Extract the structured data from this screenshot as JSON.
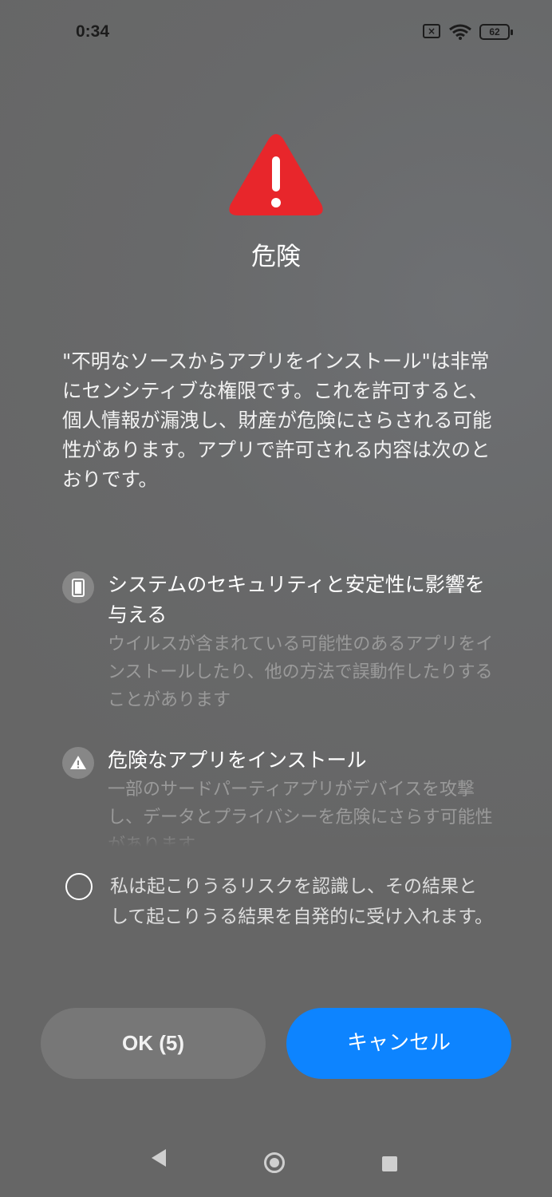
{
  "status_bar": {
    "time": "0:34",
    "battery": "62",
    "icons": [
      "sim-absent-icon",
      "wifi-icon",
      "battery-icon"
    ]
  },
  "dialog": {
    "warning_icon": "warning-triangle-icon",
    "title": "危険",
    "description": "\"不明なソースからアプリをインストール\"は非常にセンシティブな権限です。これを許可すると、個人情報が漏洩し、財産が危険にさらされる可能性があります。アプリで許可される内容は次のとおりです。",
    "items": [
      {
        "icon": "phone-icon",
        "title": "システムのセキュリティと安定性に影響を与える",
        "subtitle": "ウイルスが含まれている可能性のあるアプリをインストールしたり、他の方法で誤動作したりすることがあります"
      },
      {
        "icon": "warning-icon",
        "title": "危険なアプリをインストール",
        "subtitle": "一部のサードパーティアプリがデバイスを攻撃し、データとプライバシーを危険にさらす可能性があります"
      }
    ],
    "consent_text": "私は起こりうるリスクを認識し、その結果として起こりうる結果を自発的に受け入れます。",
    "consent_checked": false,
    "ok_label": "OK (5)",
    "cancel_label": "キャンセル",
    "colors": {
      "warning_red": "#e8262b",
      "cancel_blue": "#0d84ff",
      "ok_gray": "#777777"
    }
  },
  "nav_bar": {
    "icons": [
      "back-icon",
      "home-icon",
      "recents-icon"
    ]
  }
}
